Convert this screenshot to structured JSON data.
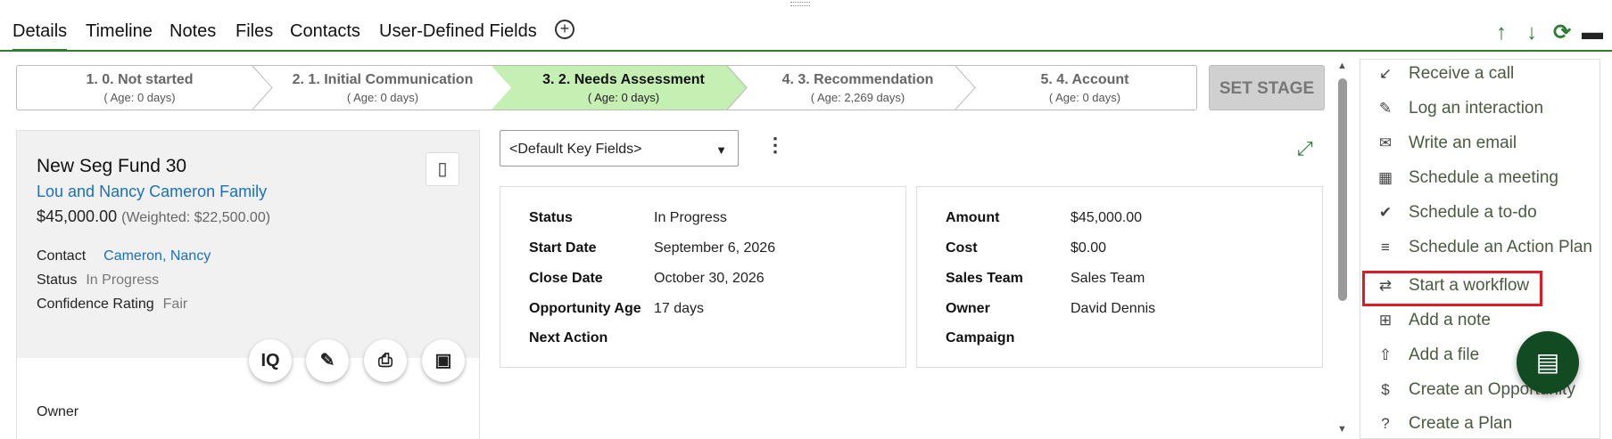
{
  "tabs": [
    {
      "label": "Details",
      "active": true
    },
    {
      "label": "Timeline"
    },
    {
      "label": "Notes"
    },
    {
      "label": "Files"
    },
    {
      "label": "Contacts"
    },
    {
      "label": "User-Defined Fields"
    }
  ],
  "toolbar_icons": [
    "add-tab-icon",
    "arrow-up-icon",
    "arrow-down-icon",
    "refresh-icon",
    "layout-menu-icon"
  ],
  "stages": [
    {
      "title": "1. 0. Not started",
      "age": "( Age: 0 days)"
    },
    {
      "title": "2. 1. Initial Communication",
      "age": "( Age: 0 days)"
    },
    {
      "title": "3. 2. Needs Assessment",
      "age": "( Age: 0 days)",
      "active": true
    },
    {
      "title": "4. 3. Recommendation",
      "age": "( Age: 2,269 days)"
    },
    {
      "title": "5. 4. Account",
      "age": "( Age: 0 days)"
    }
  ],
  "set_stage_label": "SET STAGE",
  "card": {
    "title": "New Seg Fund 30",
    "link": "Lou and Nancy Cameron Family",
    "amount": "$45,000.00",
    "weighted": "(Weighted: $22,500.00)",
    "contact_label": "Contact",
    "contact_value": "Cameron, Nancy",
    "status_label": "Status",
    "status_value": "In Progress",
    "confidence_label": "Confidence Rating",
    "confidence_value": "Fair",
    "owner_label": "Owner"
  },
  "key_fields": {
    "selected": "<Default Key Fields>"
  },
  "panel_left": [
    {
      "label": "Status",
      "value": "In Progress"
    },
    {
      "label": "Start Date",
      "value": "September 6, 2026"
    },
    {
      "label": "Close Date",
      "value": "October 30, 2026"
    },
    {
      "label": "Opportunity Age",
      "value": "17 days"
    },
    {
      "label": "Next Action",
      "value": ""
    }
  ],
  "panel_right": [
    {
      "label": "Amount",
      "value": "$45,000.00"
    },
    {
      "label": "Cost",
      "value": "$0.00"
    },
    {
      "label": "Sales Team",
      "value": "Sales Team"
    },
    {
      "label": "Owner",
      "value": "David Dennis"
    },
    {
      "label": "Campaign",
      "value": ""
    }
  ],
  "menu": [
    {
      "label": "Receive a call",
      "icon": "incoming-call-icon"
    },
    {
      "label": "Log an interaction",
      "icon": "edit-note-icon"
    },
    {
      "label": "Write an email",
      "icon": "email-icon"
    },
    {
      "label": "Schedule a meeting",
      "icon": "calendar-icon"
    },
    {
      "label": "Schedule a to-do",
      "icon": "check-circle-icon"
    },
    {
      "label": "Schedule an Action Plan",
      "icon": "playlist-icon"
    },
    {
      "label": "Start a workflow",
      "icon": "workflow-icon",
      "highlighted": true
    },
    {
      "label": "Add a note",
      "icon": "add-note-icon"
    },
    {
      "label": "Add a file",
      "icon": "upload-icon"
    },
    {
      "label": "Create an Opportunity",
      "icon": "dollar-icon"
    },
    {
      "label": "Create a Plan",
      "icon": "help-circle-icon"
    }
  ],
  "colors": {
    "accent": "#2e7d32",
    "active_stage": "#c6efb4",
    "link": "#1a6fbf",
    "highlight": "#e01b24",
    "fab": "#124a22"
  }
}
